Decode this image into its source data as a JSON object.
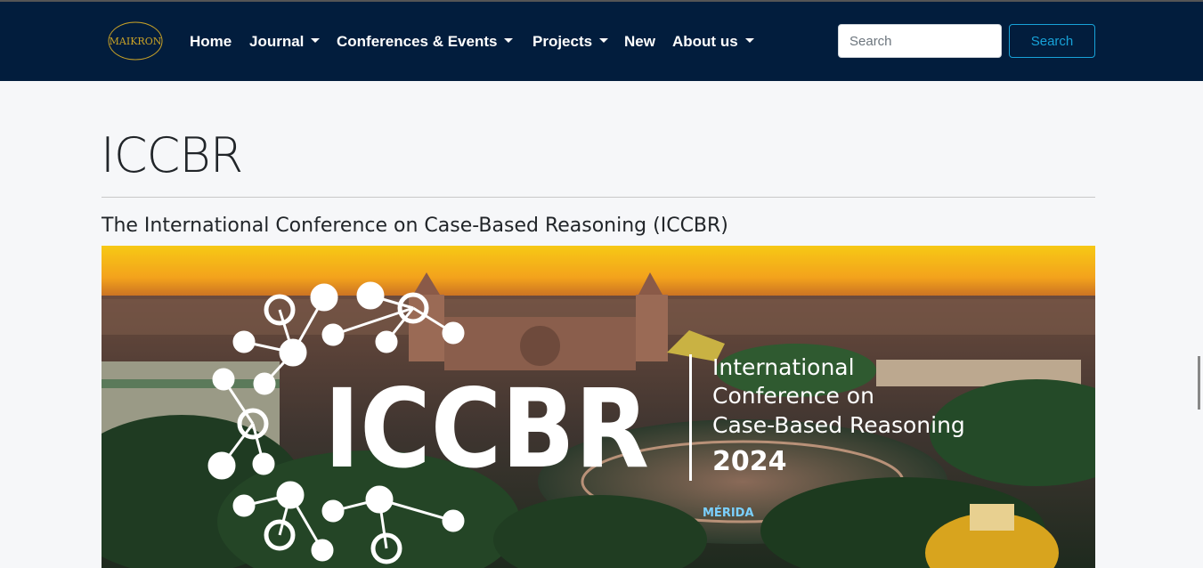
{
  "navbar": {
    "logo_text": "MAIKRON",
    "items": [
      {
        "label": "Home"
      },
      {
        "label": "Journal"
      },
      {
        "label": "Conferences & Events"
      },
      {
        "label": "Projects"
      },
      {
        "label": "New"
      },
      {
        "label": "About us"
      }
    ],
    "search": {
      "placeholder": "Search",
      "button_label": "Search"
    }
  },
  "page": {
    "title": "ICCBR",
    "subtitle": "The International Conference on Case-Based Reasoning (ICCBR)"
  },
  "banner": {
    "acronym": "ICCBR",
    "line1": "International",
    "line2": "Conference on",
    "line3": "Case-Based Reasoning",
    "year": "2024",
    "town_sign": "MÉRIDA"
  },
  "colors": {
    "navbar_bg": "#021d3d",
    "accent": "#17a2d8",
    "logo_gold": "#c9a227"
  }
}
